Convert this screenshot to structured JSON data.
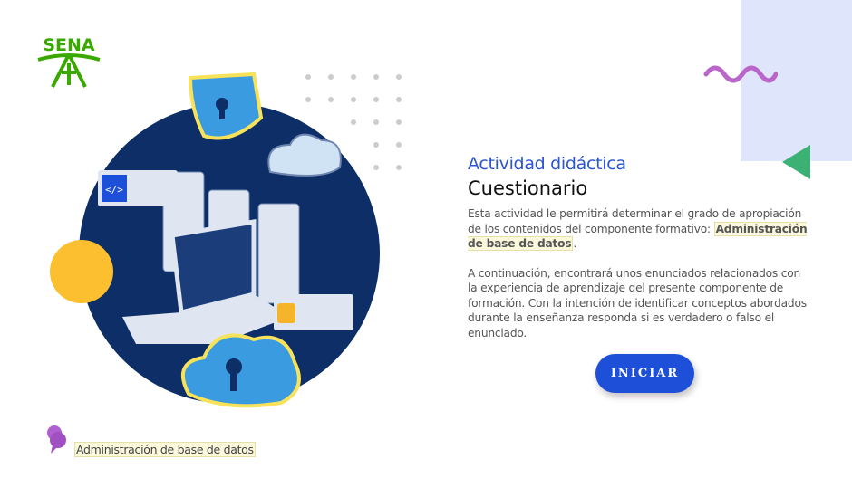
{
  "logo": {
    "text": "SENA",
    "color": "#39a900"
  },
  "content": {
    "subtitle": "Actividad didáctica",
    "title": "Cuestionario",
    "para1_prefix": "Esta actividad le permitirá determinar el grado de apropiación de los contenidos del componente formativo: ",
    "para1_highlight": "Administración de base de datos",
    "para1_suffix": ".",
    "para2": "A continuación, encontrará unos enunciados relacionados con la experiencia de aprendizaje del presente componente de formación. Con la intención de identificar conceptos abordados durante la enseñanza responda si es verdadero o falso el enunciado."
  },
  "start_button": {
    "label": "INICIAR"
  },
  "footer": {
    "label": "Administración de base de datos"
  },
  "colors": {
    "accent": "#1e4fd8",
    "navy": "#0d2e66",
    "yellow": "#fbbf2f",
    "green": "#3bb273",
    "purple": "#b05fd0"
  }
}
